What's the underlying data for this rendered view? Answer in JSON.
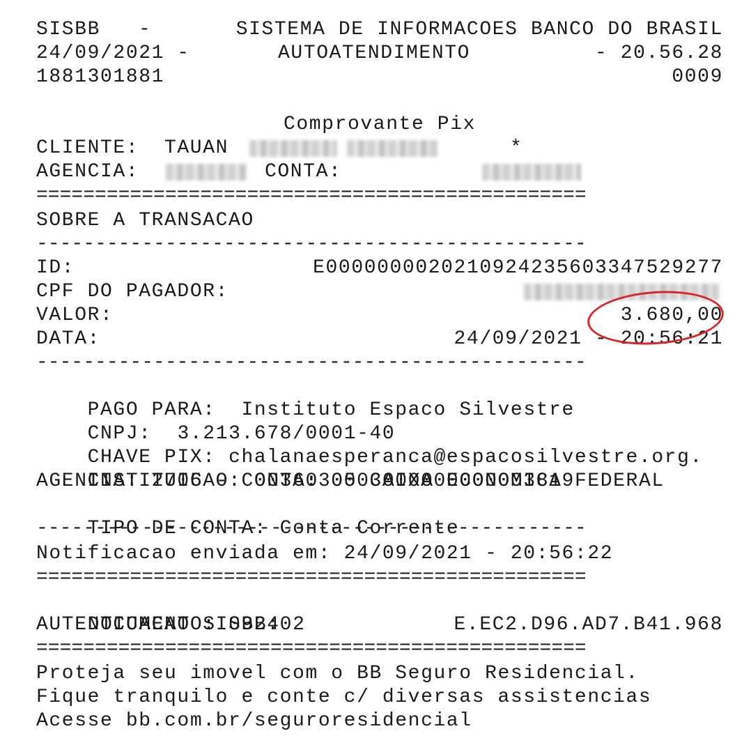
{
  "header": {
    "system": "SISBB",
    "dash": "-",
    "system_name": "SISTEMA DE INFORMACOES BANCO DO BRASIL",
    "date": "24/09/2021 -",
    "channel": "AUTOATENDIMENTO",
    "time": "- 20.56.28",
    "terminal": "1881301881",
    "seq": "0009",
    "title": "Comprovante Pix"
  },
  "client": {
    "label": "CLIENTE:",
    "first_name": "TAUAN",
    "star": "*",
    "agency_label": "AGENCIA:",
    "account_label": "CONTA:"
  },
  "separators": {
    "double": "===============================================",
    "single": "-----------------------------------------------"
  },
  "transaction": {
    "section_title": "SOBRE A TRANSACAO",
    "id_label": "ID:",
    "id_value": "E00000000202109242356033475292​77",
    "payer_cpf_label": "CPF DO PAGADOR:",
    "amount_label": "VALOR:",
    "amount_value": "3.680,00",
    "date_label": "DATA:",
    "date_value": "24/09/2021 - 20:56:21"
  },
  "payee": {
    "paid_to_label": "PAGO PARA:",
    "paid_to_value": "Instituto Espaco Silvestre",
    "cnpj_label": "CNPJ:",
    "cnpj_value": "3.213.678/0001-40",
    "pix_key_label": "CHAVE PIX:",
    "pix_key_value": "chalanaesperanca@espacosilvestre.org.",
    "institution_label": "INSTITUICAO:",
    "institution_value": "00360305 CAIXA ECONOMICA FEDERAL",
    "agency_account": "AGENCIA: 2705 - CONTA: 0003000000000003819",
    "account_type_label": "TIPO DE CONTA:",
    "account_type_value": "Conta Corrente"
  },
  "notification": "Notificacao enviada em: 24/09/2021 - 20:56:22",
  "document": {
    "doc_label": "DOCUMENTO:",
    "doc_value": "092402",
    "auth_label": "AUTENTICACAO SISBB:",
    "auth_value": "E.EC2.D96.AD7.B41.968"
  },
  "footer": {
    "line1": "Proteja seu imovel com o BB Seguro Residencial.",
    "line2": "Fique tranquilo e conte c/ diversas assistencias",
    "line3": "Acesse bb.com.br/seguroresidencial"
  },
  "colors": {
    "highlight": "#d8262b",
    "text": "#1a1a1a"
  }
}
